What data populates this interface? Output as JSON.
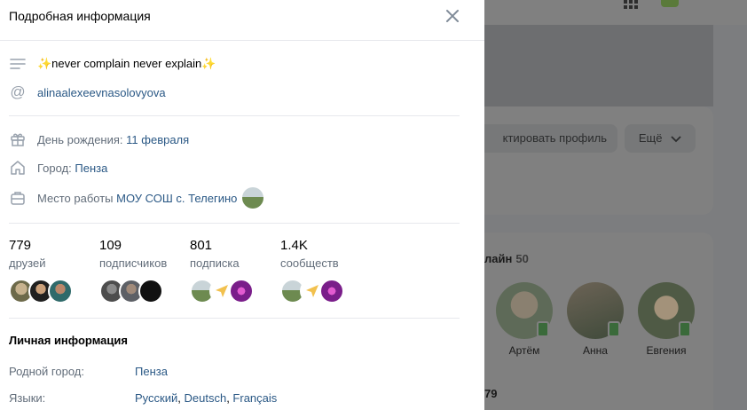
{
  "modal": {
    "title": "Подробная информация",
    "status": "✨never complain never explain✨",
    "username": "alinaalexeevnasolovyova",
    "birthday": {
      "label": "День рождения:",
      "value": "11 февраля"
    },
    "city": {
      "label": "Город:",
      "value": "Пенза"
    },
    "work": {
      "label": "Место работы",
      "value": "МОУ СОШ с. Телегино"
    },
    "stats": [
      {
        "num": "779",
        "cap": "друзей"
      },
      {
        "num": "109",
        "cap": "подписчиков"
      },
      {
        "num": "801",
        "cap": "подписка"
      },
      {
        "num": "1.4K",
        "cap": "сообществ"
      }
    ],
    "personal": {
      "title": "Личная информация",
      "hometown": {
        "label": "Родной город:",
        "value": "Пенза"
      },
      "languages": {
        "label": "Языки:",
        "values": [
          "Русский",
          "Deutsch",
          "Français"
        ],
        "sep": ", "
      }
    }
  },
  "background": {
    "edit_button": "ктировать профиль",
    "more_button": "Ещё",
    "online_label": "лайн",
    "online_count": "50",
    "friends": [
      "Артём",
      "Анна",
      "Евгения"
    ],
    "bottom_count": "79"
  },
  "colors": {
    "link": "#2a5885",
    "muted": "#626d7a",
    "divider": "#e7e8ec",
    "overlay": "#7c7d7f"
  }
}
